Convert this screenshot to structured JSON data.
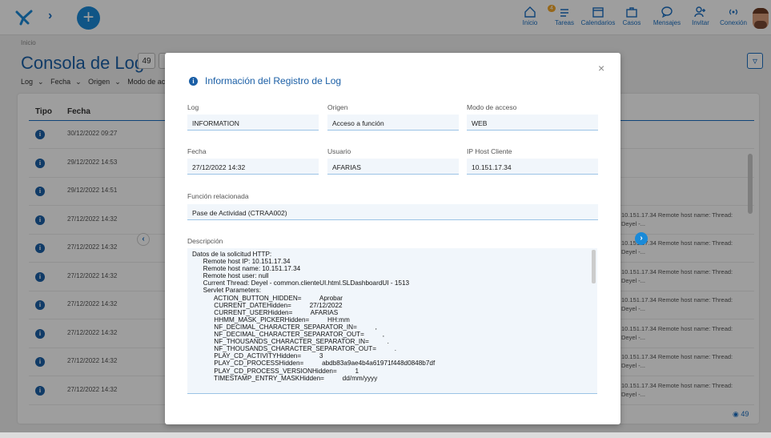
{
  "topnav": {
    "items": [
      {
        "label": "Inicio",
        "icon": "home-icon"
      },
      {
        "label": "Tareas",
        "icon": "tasks-icon",
        "badge": "4"
      },
      {
        "label": "Calendarios",
        "icon": "calendar-icon"
      },
      {
        "label": "Casos",
        "icon": "briefcase-icon"
      },
      {
        "label": "Mensajes",
        "icon": "chat-icon"
      },
      {
        "label": "Invitar",
        "icon": "add-user-icon"
      },
      {
        "label": "Conexión",
        "icon": "connection-icon"
      }
    ]
  },
  "page": {
    "breadcrumb": "Inicio",
    "title": "Consola de Logs",
    "count": "49",
    "filters": [
      "Log",
      "Fecha",
      "Origen",
      "Modo de acceso"
    ],
    "footer_count": "49"
  },
  "table": {
    "headers": [
      "Tipo",
      "Fecha"
    ],
    "rows": [
      {
        "date": "30/12/2022 09:27",
        "desc": ""
      },
      {
        "date": "29/12/2022 14:53",
        "desc": ""
      },
      {
        "date": "29/12/2022 14:51",
        "desc": ""
      },
      {
        "date": "27/12/2022 14:32",
        "desc": "10.151.17.34 Remote host name: Thread: Deyel -..."
      },
      {
        "date": "27/12/2022 14:32",
        "desc": "10.151.17.34 Remote host name: Thread: Deyel -..."
      },
      {
        "date": "27/12/2022 14:32",
        "desc": "10.151.17.34 Remote host name: Thread: Deyel -..."
      },
      {
        "date": "27/12/2022 14:32",
        "desc": "10.151.17.34 Remote host name: Thread: Deyel -..."
      },
      {
        "date": "27/12/2022 14:32",
        "desc": "10.151.17.34 Remote host name: Thread: Deyel -..."
      },
      {
        "date": "27/12/2022 14:32",
        "desc": "10.151.17.34 Remote host name: Thread: Deyel -..."
      },
      {
        "date": "27/12/2022 14:32",
        "desc": "10.151.17.34 Remote host name: Thread: Deyel -..."
      }
    ]
  },
  "modal": {
    "title": "Información del Registro de Log",
    "close": "×",
    "fields": {
      "log": {
        "label": "Log",
        "value": "INFORMATION"
      },
      "origen": {
        "label": "Origen",
        "value": "Acceso a función"
      },
      "modo": {
        "label": "Modo de acceso",
        "value": "WEB"
      },
      "fecha": {
        "label": "Fecha",
        "value": "27/12/2022 14:32"
      },
      "usuario": {
        "label": "Usuario",
        "value": "AFARIAS"
      },
      "ip": {
        "label": "IP Host Cliente",
        "value": "10.151.17.34"
      },
      "funcion": {
        "label": "Función relacionada",
        "value": "Pase de Actividad (CTRAA002)"
      }
    },
    "description_label": "Descripción",
    "description_lines": [
      "Datos de la solicitud HTTP:",
      "      Remote host IP: 10.151.17.34",
      "      Remote host name: 10.151.17.34",
      "      Remote host user: null",
      "      Current Thread: Deyel - common.clienteUI.html.SLDashboardUI - 1513",
      "      Servlet Parameters:",
      "            ACTION_BUTTON_HIDDEN=          Aprobar",
      "            CURRENT_DATEHidden=          27/12/2022",
      "            CURRENT_USERHidden=          AFARIAS",
      "            HHMM_MASK_PICKERHidden=          HH:mm",
      "            NF_DECIMAL_CHARACTER_SEPARATOR_IN=          ,",
      "            NF_DECIMAL_CHARACTER_SEPARATOR_OUT=          ,",
      "            NF_THOUSANDS_CHARACTER_SEPARATOR_IN=          .",
      "            NF_THOUSANDS_CHARACTER_SEPARATOR_OUT=          .",
      "            PLAY_CD_ACTIVITYHidden=          3",
      "            PLAY_CD_PROCESSHidden=          abdb83a9ae4b4a61971f448d0848b7df",
      "            PLAY_CD_PROCESS_VERSIONHidden=          1",
      "            TIMESTAMP_ENTRY_MASKHidden=          dd/mm/yyyy"
    ]
  },
  "colors": {
    "accent": "#1a6fc2",
    "badge": "#f2a62a"
  }
}
